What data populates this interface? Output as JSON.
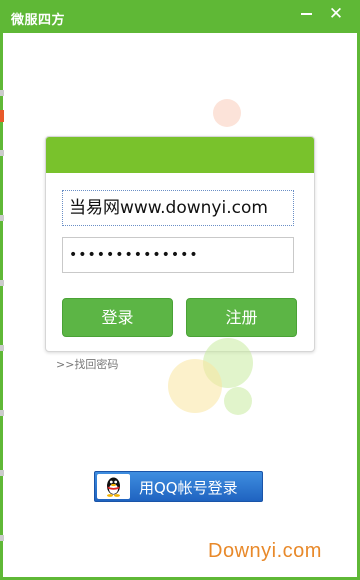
{
  "window": {
    "title": "微服四方",
    "minimize_label": "—",
    "close_label": "✕"
  },
  "login": {
    "username_value": "当易网www.downyi.com",
    "password_value": "••••••••••••••",
    "login_button": "登录",
    "register_button": "注册",
    "find_password_link": ">>找回密码"
  },
  "qq_login": {
    "label": "用QQ帐号登录",
    "icon": "qq-penguin-icon"
  },
  "watermark": "Downyi.com",
  "colors": {
    "titlebar": "#5fb836",
    "panel_header": "#79c22c",
    "button": "#5cb545",
    "qq_button": "#2b74d0",
    "watermark": "#e8892a"
  }
}
